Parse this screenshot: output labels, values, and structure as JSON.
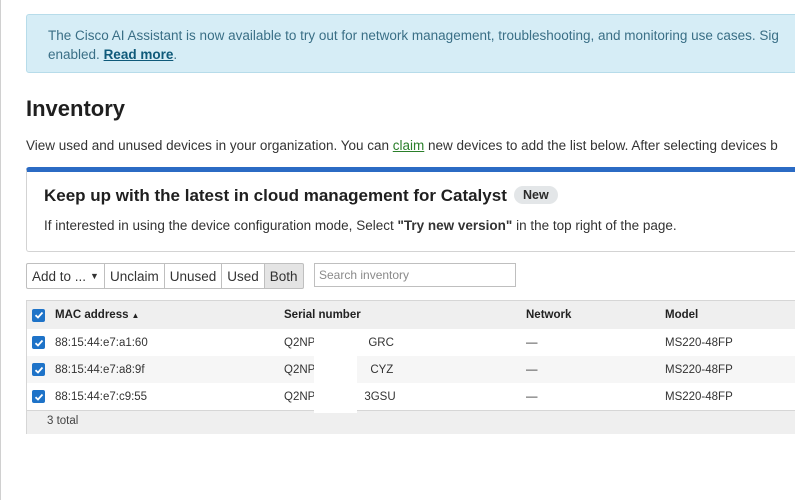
{
  "banner": {
    "text": "The Cisco AI Assistant is now available to try out for network management, troubleshooting, and monitoring use cases. Sig",
    "text2": "enabled. ",
    "link": "Read more",
    "end": "."
  },
  "page": {
    "title": "Inventory",
    "desc_pre": "View used and unused devices in your organization. You can ",
    "desc_link": "claim",
    "desc_post": " new devices to add the list below. After selecting devices b"
  },
  "card": {
    "title": "Keep up with the latest in cloud management for Catalyst",
    "badge": "New",
    "text_pre": "If interested in using the device configuration mode, Select ",
    "text_bold": "\"Try new version\"",
    "text_post": " in the top right of the page."
  },
  "toolbar": {
    "add_label": "Add to ...",
    "unclaim_label": "Unclaim",
    "unused_label": "Unused",
    "used_label": "Used",
    "both_label": "Both",
    "active_filter": "Both"
  },
  "search": {
    "placeholder": "Search inventory"
  },
  "table": {
    "columns": {
      "mac": "MAC address",
      "serial": "Serial number",
      "network": "Network",
      "model": "Model"
    },
    "sort": {
      "column": "MAC address",
      "direction": "ascending"
    },
    "rows": [
      {
        "mac": "88:15:44:e7:a1:60",
        "serial_start": "Q2NP",
        "serial_end": "GRC",
        "network": "—",
        "model": "MS220-48FP",
        "checked": true
      },
      {
        "mac": "88:15:44:e7:a8:9f",
        "serial_start": "Q2NP",
        "serial_end": "CYZ",
        "network": "—",
        "model": "MS220-48FP",
        "checked": true
      },
      {
        "mac": "88:15:44:e7:c9:55",
        "serial_start": "Q2NP",
        "serial_end": "3GSU",
        "network": "—",
        "model": "MS220-48FP",
        "checked": true
      }
    ],
    "footer": "3 total"
  },
  "colors": {
    "accent": "#1e73c8",
    "banner_bg": "#d6edf6",
    "card_border": "#2b6bc4",
    "link_green": "#2a7f2a"
  },
  "icons": {
    "checkbox": "check-icon",
    "sort": "sort-up-icon",
    "dropdown": "caret-down-icon"
  }
}
